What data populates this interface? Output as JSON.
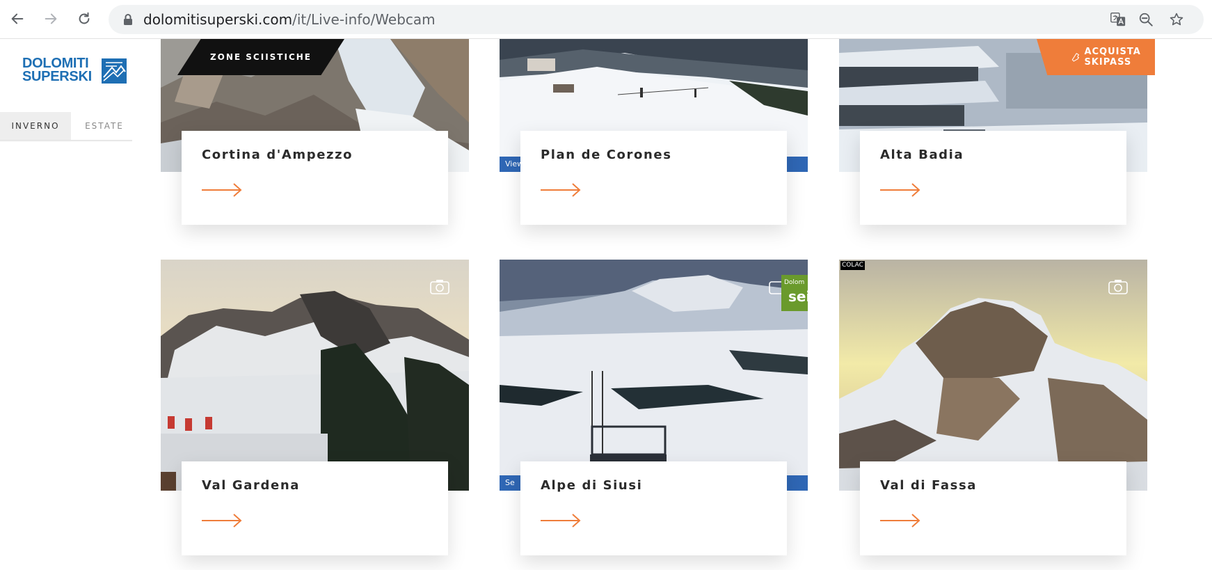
{
  "browser": {
    "url_host": "dolomitisuperski.com",
    "url_path": "/it/Live-info/Webcam",
    "icons": [
      "back-icon",
      "forward-icon",
      "reload-icon",
      "lock-icon",
      "translate-icon",
      "zoom-out-icon",
      "bookmark-star-icon"
    ]
  },
  "header": {
    "logo_line1": "DOLOMITI",
    "logo_line2": "SUPERSKI",
    "zone_label": "ZONE SCIISTICHE",
    "skipass_label": "ACQUISTA SKIPASS",
    "season_tabs": [
      {
        "label": "INVERNO",
        "active": true
      },
      {
        "label": "ESTATE",
        "active": false
      }
    ]
  },
  "colors": {
    "accent": "#ef7d3a",
    "brand_blue": "#1e6fb4",
    "title_text": "#2b2b2b"
  },
  "cards": [
    {
      "title": "Cortina d'Ampezzo"
    },
    {
      "title": "Plan de Corones",
      "strip_text": "View"
    },
    {
      "title": "Alta Badia"
    },
    {
      "title": "Val Gardena"
    },
    {
      "title": "Alpe di Siusi",
      "strip_text": "Se",
      "badge_small": "Dolom",
      "badge_big": "sei"
    },
    {
      "title": "Val di Fassa",
      "watermark": "COLAC"
    }
  ]
}
